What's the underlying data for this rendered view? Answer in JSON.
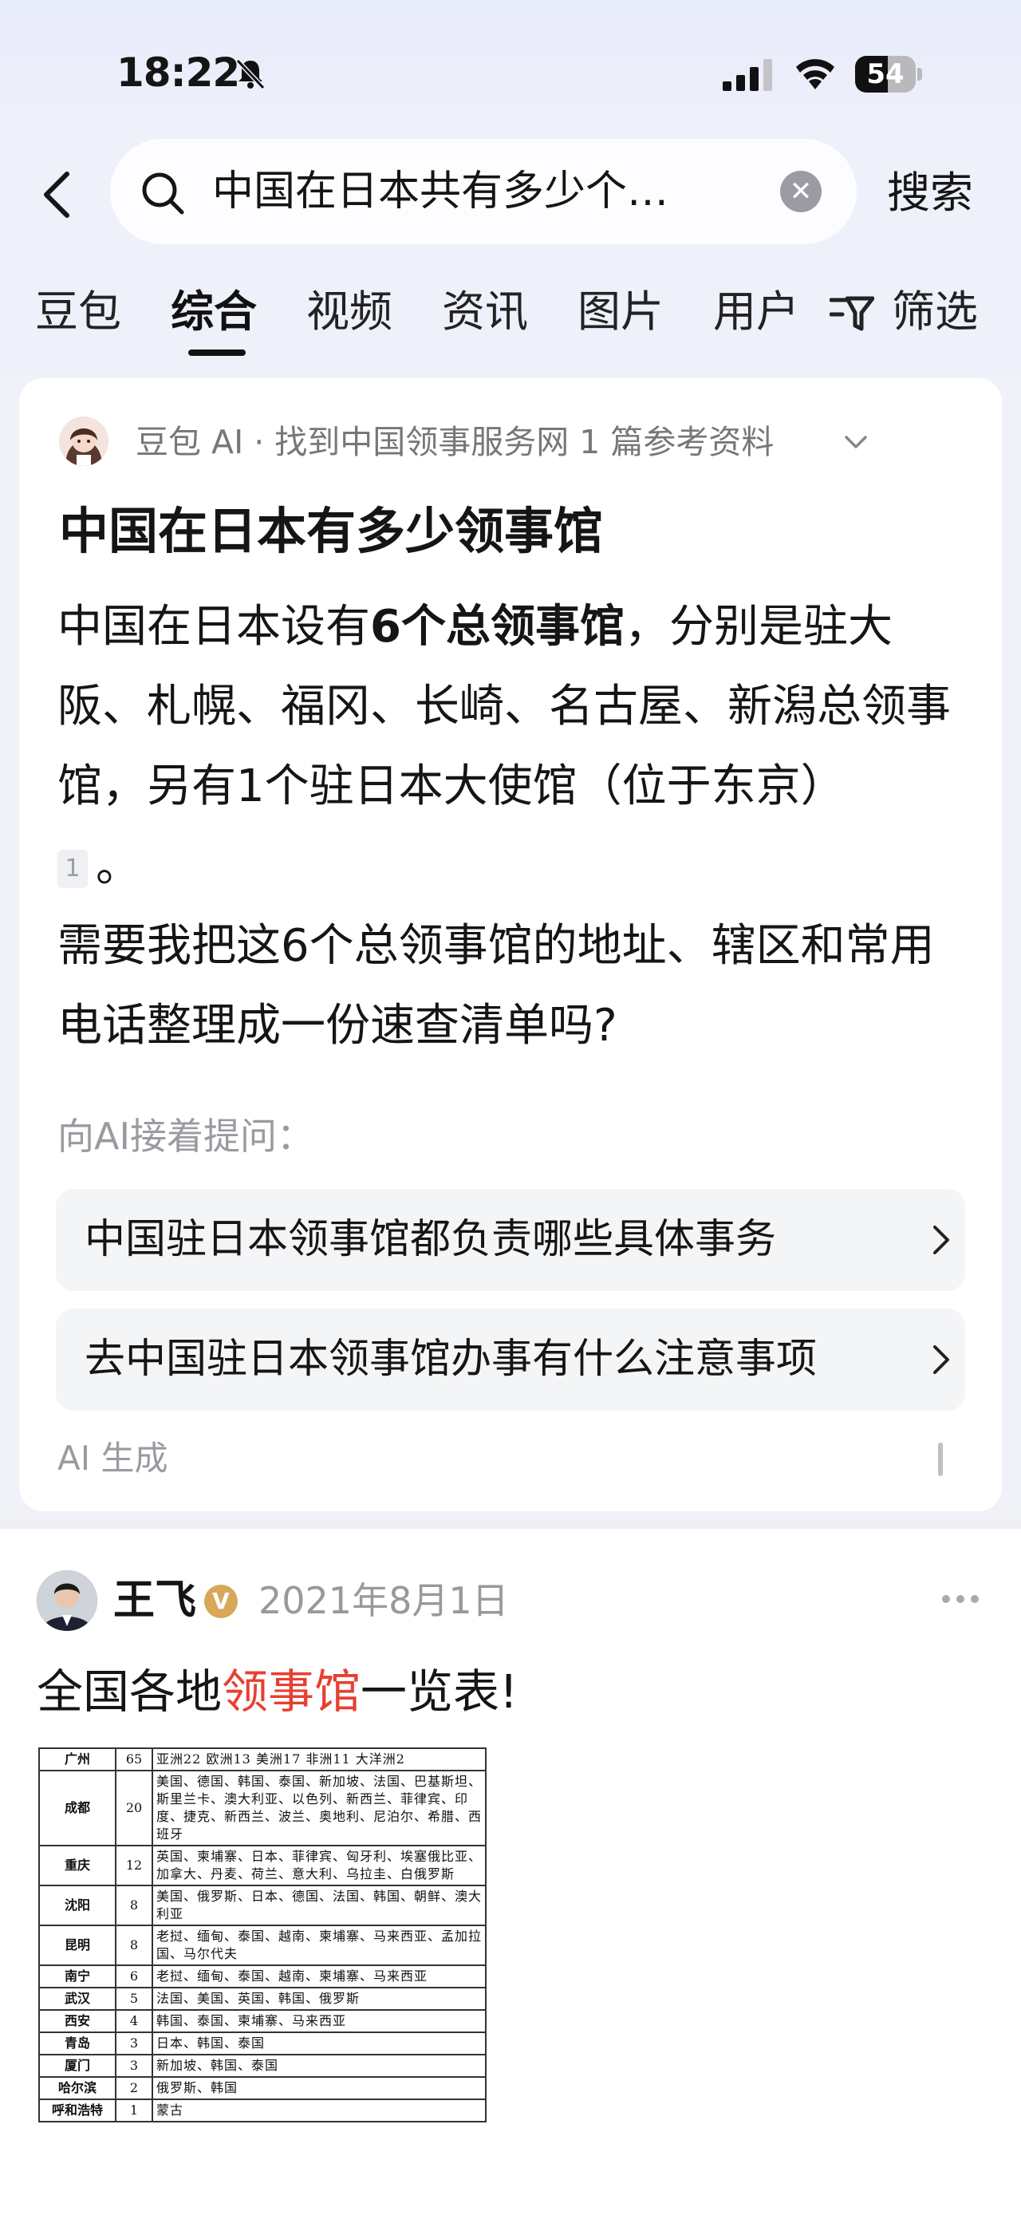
{
  "status_bar": {
    "time": "18:22",
    "battery": "54",
    "battery_level": 0.54
  },
  "search": {
    "query": "中国在日本共有多少个…",
    "submit_label": "搜索"
  },
  "tabs": [
    {
      "label": "豆包"
    },
    {
      "label": "综合",
      "active": true
    },
    {
      "label": "视频"
    },
    {
      "label": "资讯"
    },
    {
      "label": "图片"
    },
    {
      "label": "用户"
    }
  ],
  "filter_label": "筛选",
  "ai_card": {
    "source": "豆包 AI · 找到中国领事服务网 1 篇参考资料",
    "title": "中国在日本有多少领事馆",
    "answer_p1_before": "中国在日本设有",
    "answer_p1_bold": "6个总领事馆",
    "answer_p1_after": "，分别是驻大阪、札幌、福冈、长崎、名古屋、新潟总领事馆，另有1个驻日本大使馆（位于东京）",
    "citation": "1",
    "answer_p1_end": "。",
    "answer_p2": "需要我把这6个总领事馆的地址、辖区和常用电话整理成一份速查清单吗?",
    "followup_label": "向AI接着提问：",
    "followups": [
      {
        "label": "中国驻日本领事馆都负责哪些具体事务"
      },
      {
        "label": "去中国驻日本领事馆办事有什么注意事项"
      }
    ],
    "generated_label": "AI 生成"
  },
  "post": {
    "author": "王飞",
    "verified_mark": "V",
    "date": "2021年8月1日",
    "text_before": "全国各地",
    "text_highlight": "领事馆",
    "text_after": "一览表!",
    "table": [
      {
        "city": "广州",
        "count": "65",
        "countries": "亚洲22 欧洲13 美洲17 非洲11 大洋洲2"
      },
      {
        "city": "成都",
        "count": "20",
        "countries": "美国、德国、韩国、泰国、新加坡、法国、巴基斯坦、斯里兰卡、澳大利亚、以色列、新西兰、菲律宾、印度、捷克、新西兰、波兰、奥地利、尼泊尔、希腊、西班牙"
      },
      {
        "city": "重庆",
        "count": "12",
        "countries": "英国、柬埔寨、日本、菲律宾、匈牙利、埃塞俄比亚、加拿大、丹麦、荷兰、意大利、乌拉圭、白俄罗斯"
      },
      {
        "city": "沈阳",
        "count": "8",
        "countries": "美国、俄罗斯、日本、德国、法国、韩国、朝鲜、澳大利亚"
      },
      {
        "city": "昆明",
        "count": "8",
        "countries": "老挝、缅甸、泰国、越南、柬埔寨、马来西亚、孟加拉国、马尔代夫"
      },
      {
        "city": "南宁",
        "count": "6",
        "countries": "老挝、缅甸、泰国、越南、柬埔寨、马来西亚"
      },
      {
        "city": "武汉",
        "count": "5",
        "countries": "法国、美国、英国、韩国、俄罗斯"
      },
      {
        "city": "西安",
        "count": "4",
        "countries": "韩国、泰国、柬埔寨、马来西亚"
      },
      {
        "city": "青岛",
        "count": "3",
        "countries": "日本、韩国、泰国"
      },
      {
        "city": "厦门",
        "count": "3",
        "countries": "新加坡、韩国、泰国"
      },
      {
        "city": "哈尔滨",
        "count": "2",
        "countries": "俄罗斯、韩国"
      },
      {
        "city": "呼和浩特",
        "count": "1",
        "countries": "蒙古"
      }
    ]
  }
}
